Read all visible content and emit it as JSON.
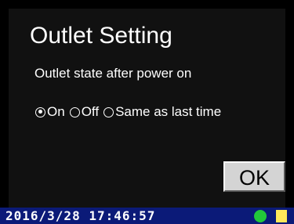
{
  "screen": {
    "title": "Outlet Setting",
    "subtitle": "Outlet state after power on",
    "options": [
      {
        "label": "On",
        "selected": true
      },
      {
        "label": "Off",
        "selected": false
      },
      {
        "label": "Same as last time",
        "selected": false
      }
    ],
    "ok_label": "OK"
  },
  "status_bar": {
    "datetime": "2016/3/28 17:46:57",
    "led_color": "#22c83a",
    "square_color": "#ffe85a"
  }
}
